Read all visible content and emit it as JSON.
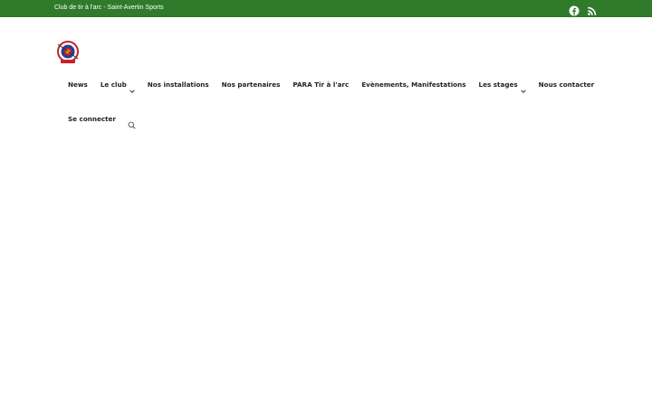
{
  "topbar": {
    "tagline": "Club de tir à l'arc - Saint-Avertin Sports",
    "social": [
      {
        "icon": "facebook-icon"
      },
      {
        "icon": "rss-icon"
      }
    ]
  },
  "colors": {
    "topbar_bg": "#2f7a2b",
    "text": "#222222"
  },
  "nav": {
    "items": [
      {
        "label": "News"
      },
      {
        "label": "Le club"
      },
      {
        "label": "Nos installations"
      },
      {
        "label": "Nos partenaires"
      },
      {
        "label": "PARA Tir à l'arc"
      },
      {
        "label": "Evènements, Manifestations"
      },
      {
        "label": "Les stages"
      },
      {
        "label": "Nous contacter"
      },
      {
        "label": "Se connecter"
      }
    ]
  }
}
